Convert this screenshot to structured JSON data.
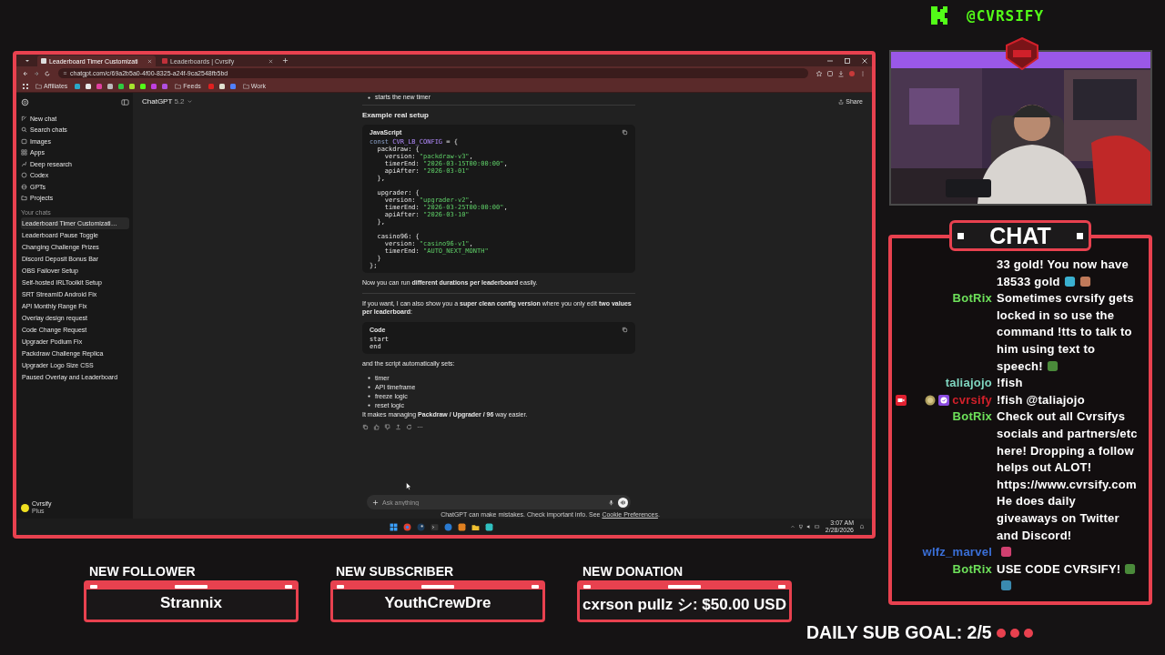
{
  "channel": {
    "handle": "@CVRSIFY"
  },
  "browser": {
    "tabs": [
      {
        "title": "Leaderboard Timer Customizati",
        "selected": true
      },
      {
        "title": "Leaderboards | Cvrsify",
        "selected": false
      }
    ],
    "address": "chatgpt.com/c/69a2b5a0-4f00-8325-a24f-9ca2548fb5bd",
    "bookmarks": [
      {
        "kind": "folder",
        "label": "Affiliates"
      },
      {
        "kind": "site",
        "color": "#2aa8c8"
      },
      {
        "kind": "site",
        "color": "#e8e8e8"
      },
      {
        "kind": "site",
        "color": "#e040a0"
      },
      {
        "kind": "site",
        "color": "#bbbbbb"
      },
      {
        "kind": "site",
        "color": "#2ecc40"
      },
      {
        "kind": "site",
        "color": "#a6e22e"
      },
      {
        "kind": "site",
        "color": "#53fc18"
      },
      {
        "kind": "site",
        "color": "#c040e0"
      },
      {
        "kind": "site",
        "color": "#b050e0"
      },
      {
        "kind": "folder",
        "label": "Feeds"
      },
      {
        "kind": "site",
        "color": "#e02020"
      },
      {
        "kind": "site",
        "color": "#e0e0d0"
      },
      {
        "kind": "site",
        "color": "#5080ff"
      },
      {
        "kind": "folder",
        "label": "Work"
      }
    ]
  },
  "chatgpt": {
    "model": "ChatGPT",
    "version": "5.2",
    "share": "Share",
    "nav": [
      {
        "label": "New chat",
        "kind": "new"
      },
      {
        "label": "Search chats",
        "kind": "search"
      },
      {
        "label": "Images",
        "kind": "images"
      },
      {
        "label": "Apps",
        "kind": "apps"
      },
      {
        "label": "Deep research",
        "kind": "research"
      },
      {
        "label": "Codex",
        "kind": "codex"
      },
      {
        "label": "GPTs",
        "kind": "gpts"
      },
      {
        "label": "Projects",
        "kind": "projects"
      }
    ],
    "chats_heading": "Your chats",
    "chats": [
      {
        "title": "Leaderboard Timer Customizati…",
        "selected": true
      },
      {
        "title": "Leaderboard Pause Toggle",
        "selected": false
      },
      {
        "title": "Changing Challenge Prizes",
        "selected": false
      },
      {
        "title": "Discord Deposit Bonus Bar",
        "selected": false
      },
      {
        "title": "OBS Failover Setup",
        "selected": false
      },
      {
        "title": "Self-hosted IRLToolkit Setup",
        "selected": false
      },
      {
        "title": "SRT StreamID Android Fix",
        "selected": false
      },
      {
        "title": "API Monthly Range Fix",
        "selected": false
      },
      {
        "title": "Overlay design request",
        "selected": false
      },
      {
        "title": "Code Change Request",
        "selected": false
      },
      {
        "title": "Upgrader Podium Fix",
        "selected": false
      },
      {
        "title": "Packdraw Challenge Replica",
        "selected": false
      },
      {
        "title": "Upgrader Logo Size CSS",
        "selected": false
      },
      {
        "title": "Paused Overlay and Leaderboard",
        "selected": false
      }
    ],
    "user": {
      "name": "Cvrsify",
      "plan": "Plus"
    },
    "conversation": [
      {
        "kind": "bullets",
        "items": [
          "starts the new timer"
        ]
      },
      {
        "kind": "divider"
      },
      {
        "kind": "heading",
        "text": "Example real setup"
      },
      {
        "kind": "code",
        "language": "JavaScript",
        "lines": [
          {
            "segments": [
              {
                "kind": "keyword",
                "text": "const "
              },
              {
                "kind": "name",
                "text": "CVR_LB_CONFIG"
              },
              {
                "kind": "plain",
                "text": " = {"
              }
            ]
          },
          {
            "segments": [
              {
                "kind": "plain",
                "text": "  packdraw: {"
              }
            ]
          },
          {
            "segments": [
              {
                "kind": "plain",
                "text": "    version: "
              },
              {
                "kind": "string",
                "text": "\"packdraw-v3\""
              },
              {
                "kind": "plain",
                "text": ","
              }
            ]
          },
          {
            "segments": [
              {
                "kind": "plain",
                "text": "    timerEnd: "
              },
              {
                "kind": "string",
                "text": "\"2026-03-15T00:00:00\""
              },
              {
                "kind": "plain",
                "text": ","
              }
            ]
          },
          {
            "segments": [
              {
                "kind": "plain",
                "text": "    apiAfter: "
              },
              {
                "kind": "string",
                "text": "\"2026-03-01\""
              }
            ]
          },
          {
            "segments": [
              {
                "kind": "plain",
                "text": "  },"
              }
            ]
          },
          {
            "gap_before": true,
            "segments": [
              {
                "kind": "plain",
                "text": "  upgrader: {"
              }
            ]
          },
          {
            "segments": [
              {
                "kind": "plain",
                "text": "    version: "
              },
              {
                "kind": "string",
                "text": "\"upgrader-v2\""
              },
              {
                "kind": "plain",
                "text": ","
              }
            ]
          },
          {
            "segments": [
              {
                "kind": "plain",
                "text": "    timerEnd: "
              },
              {
                "kind": "string",
                "text": "\"2026-03-25T00:00:00\""
              },
              {
                "kind": "plain",
                "text": ","
              }
            ]
          },
          {
            "segments": [
              {
                "kind": "plain",
                "text": "    apiAfter: "
              },
              {
                "kind": "string",
                "text": "\"2026-03-10\""
              }
            ]
          },
          {
            "segments": [
              {
                "kind": "plain",
                "text": "  },"
              }
            ]
          },
          {
            "gap_before": true,
            "segments": [
              {
                "kind": "plain",
                "text": "  casino96: {"
              }
            ]
          },
          {
            "segments": [
              {
                "kind": "plain",
                "text": "    version: "
              },
              {
                "kind": "string",
                "text": "\"casino96-v1\""
              },
              {
                "kind": "plain",
                "text": ","
              }
            ]
          },
          {
            "segments": [
              {
                "kind": "plain",
                "text": "    timerEnd: "
              },
              {
                "kind": "string",
                "text": "\"AUTO_NEXT_MONTH\""
              }
            ]
          },
          {
            "segments": [
              {
                "kind": "plain",
                "text": "  }"
              }
            ]
          },
          {
            "segments": [
              {
                "kind": "plain",
                "text": "};"
              }
            ]
          }
        ]
      },
      {
        "kind": "paragraph",
        "text": "Now you can run **different durations per leaderboard** easily."
      },
      {
        "kind": "divider"
      },
      {
        "kind": "paragraph",
        "text": "If you want, I can also show you a **super clean config version** where you only edit **two values per leaderboard**:"
      },
      {
        "kind": "code",
        "language": "Code",
        "lines": [
          {
            "segments": [
              {
                "kind": "plain",
                "text": "start"
              }
            ]
          },
          {
            "segments": [
              {
                "kind": "plain",
                "text": "end"
              }
            ]
          }
        ]
      },
      {
        "kind": "paragraph",
        "text": "and the script automatically sets:"
      },
      {
        "kind": "bullets",
        "items": [
          "timer",
          "API timeframe",
          "freeze logic",
          "reset logic"
        ]
      },
      {
        "kind": "paragraph",
        "text": "It makes managing **Packdraw / Upgrader / 96** way easier."
      },
      {
        "kind": "actions"
      }
    ],
    "composer": {
      "placeholder": "Ask anything"
    },
    "disclaimer": "ChatGPT can make mistakes. Check important info. See",
    "disclaimer_link": "Cookie Preferences",
    "disclaimer_end": "."
  },
  "taskbar": {
    "time": "3:07 AM",
    "date": "2/28/2026"
  },
  "chat": {
    "title": "CHAT",
    "messages": [
      {
        "parts": [
          {
            "kind": "text",
            "text": "33 gold! You now have 18533 gold"
          },
          {
            "kind": "emote",
            "color": "#3ab0d0"
          },
          {
            "kind": "emote",
            "color": "#c07a5a"
          }
        ]
      },
      {
        "user": "BotRix",
        "color": "#6de05a",
        "parts": [
          {
            "kind": "text",
            "text": "Sometimes cvrsify gets locked in so use the command !tts to talk to him using text to speech!"
          },
          {
            "kind": "emote",
            "color": "#4a8a3a"
          }
        ]
      },
      {
        "user": "taliajojo",
        "color": "#7fd6c0",
        "parts": [
          {
            "kind": "text",
            "text": "!fish"
          }
        ]
      },
      {
        "user": "cvrsify",
        "color": "#d0202a",
        "badges": [
          {
            "kind": "broadcaster"
          },
          {
            "kind": "gift"
          },
          {
            "kind": "verified"
          }
        ],
        "parts": [
          {
            "kind": "text",
            "text": "!fish @taliajojo"
          }
        ]
      },
      {
        "user": "BotRix",
        "color": "#6de05a",
        "parts": [
          {
            "kind": "text",
            "text": "Check out all Cvrsifys socials and partners/etc here! Dropping a follow helps out ALOT! https://www.cvrsify.com He does daily giveaways on Twitter and Discord!"
          }
        ]
      },
      {
        "user": "wlfz_marvel",
        "color": "#3a6fd8",
        "parts": [
          {
            "kind": "emote",
            "color": "#d04070"
          }
        ]
      },
      {
        "user": "BotRix",
        "color": "#6de05a",
        "parts": [
          {
            "kind": "text",
            "text": "USE CODE CVRSIFY!"
          },
          {
            "kind": "emote",
            "color": "#4a8a3a"
          },
          {
            "kind": "emote",
            "color": "#3a8ab0"
          }
        ]
      }
    ]
  },
  "alerts": [
    {
      "label": "NEW FOLLOWER",
      "value": "Strannix"
    },
    {
      "label": "NEW SUBSCRIBER",
      "value": "YouthCrewDre"
    },
    {
      "label": "NEW DONATION",
      "value": "cxrson pullz シ: $50.00 USD"
    }
  ],
  "sub_goal": {
    "text": "DAILY SUB GOAL: 2/5"
  }
}
